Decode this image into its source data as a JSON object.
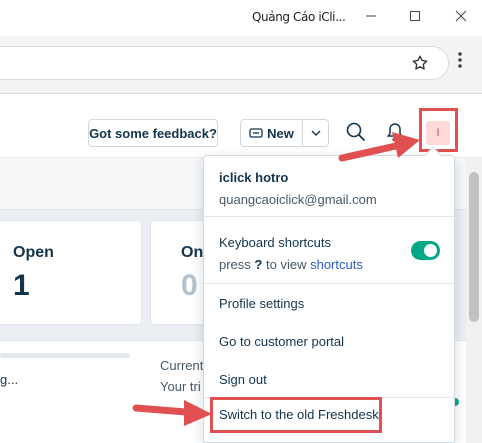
{
  "window": {
    "title": "Quảng Cáo iCli..."
  },
  "header": {
    "feedback_label": "Got some feedback?",
    "new_label": "New",
    "avatar_initial": "I"
  },
  "cards": [
    {
      "label": "Open",
      "value": "1"
    },
    {
      "label": "On",
      "value": "0"
    }
  ],
  "lower": {
    "left_text": "g...",
    "current_text": "Current",
    "trial_text": "Your tri"
  },
  "profile_menu": {
    "name": "iclick hotro",
    "email": "quangcaoiclick@gmail.com",
    "keyboard_shortcuts": {
      "title": "Keyboard shortcuts",
      "hint_prefix": "press",
      "hint_key": "?",
      "hint_middle": "to view",
      "hint_link": "shortcuts",
      "enabled": true
    },
    "items": {
      "profile_settings": "Profile settings",
      "customer_portal": "Go to customer portal",
      "sign_out": "Sign out",
      "switch_old": "Switch to the old Freshdesk"
    }
  },
  "colors": {
    "annotation_red": "#e05050",
    "toggle_green": "#00a886",
    "link_blue": "#2c5cc5",
    "text_dark": "#12344d"
  }
}
